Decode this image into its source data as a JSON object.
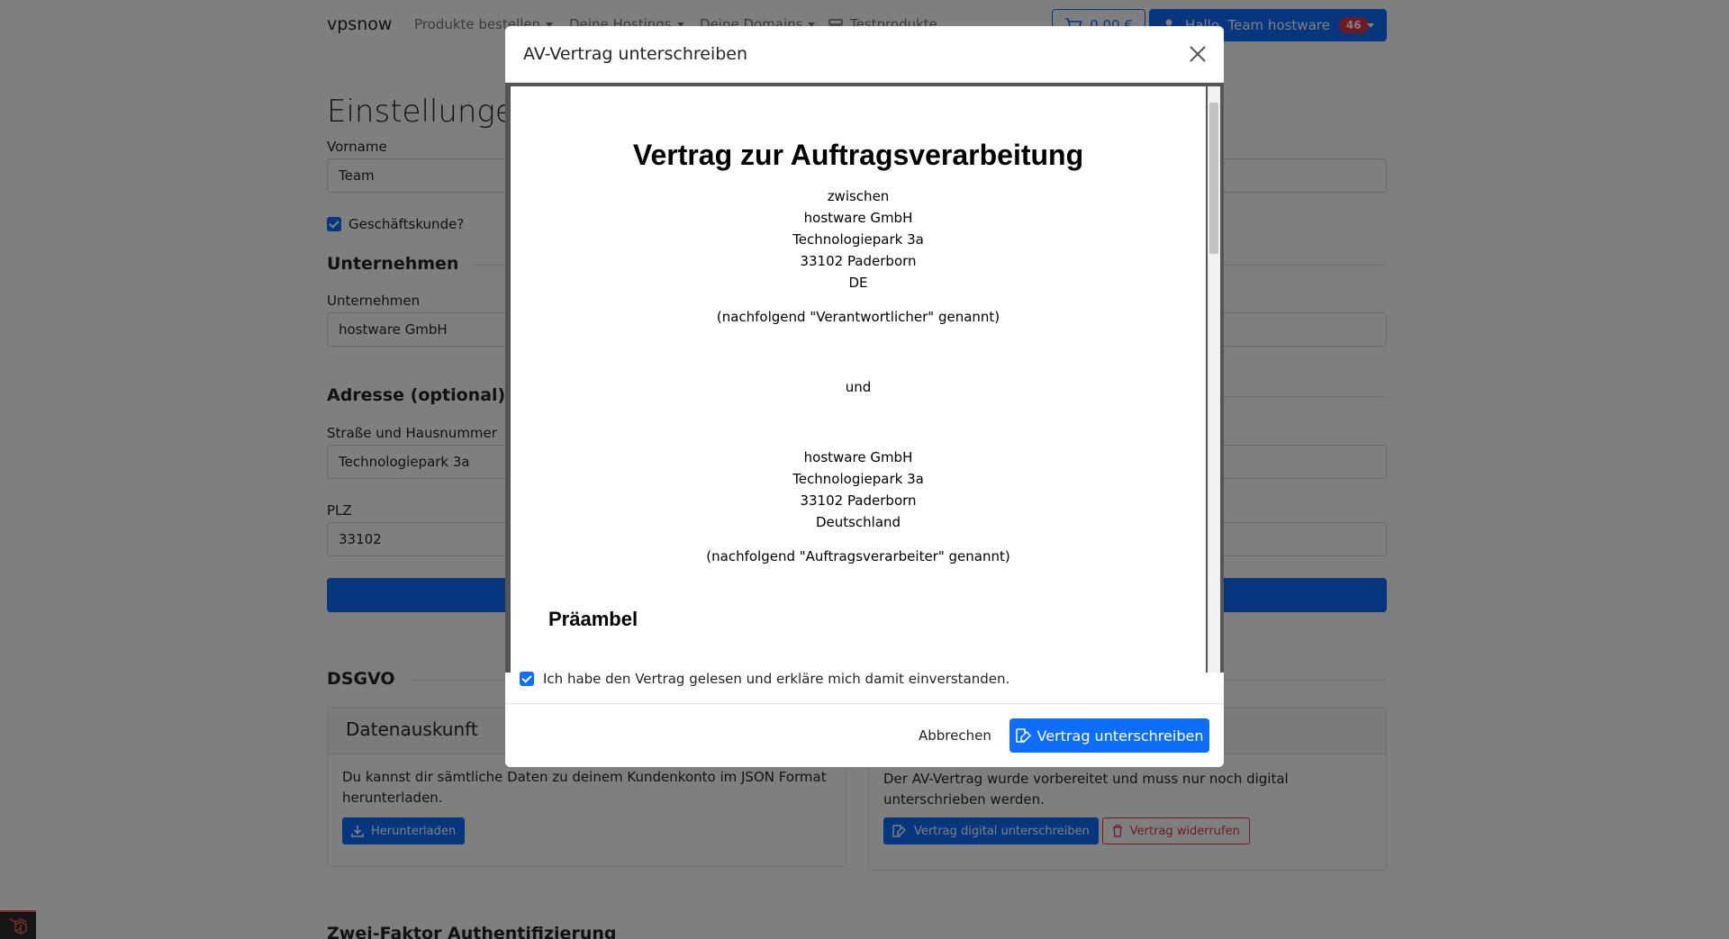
{
  "nav": {
    "brand": "vpsnow",
    "items": [
      "Produkte bestellen",
      "Deine Hostings",
      "Deine Domains",
      "Testprodukte"
    ],
    "cart_label": "0,00 €",
    "user_label": "Hallo, Team hostware",
    "user_badge": "46"
  },
  "page": {
    "title": "Einstellungen",
    "vorname_label": "Vorname",
    "vorname_value": "Team",
    "business_label": "Geschäftskunde?",
    "company_section": "Unternehmen",
    "company_label": "Unternehmen",
    "company_value": "hostware GmbH",
    "address_section": "Adresse (optional)",
    "street_label": "Straße und Hausnummer",
    "street_value": "Technologiepark 3a",
    "zip_label": "PLZ",
    "zip_value": "33102",
    "dsgvo_section": "DSGVO",
    "twofa_section": "Zwei-Faktor Authentifizierung",
    "data_card": {
      "title": "Datenauskunft",
      "text": "Du kannst dir sämtliche Daten zu deinem Kundenkonto im JSON Format herunterladen.",
      "button": "Herunterladen"
    },
    "av_card": {
      "text": "Der AV-Vertrag wurde vorbereitet und muss nur noch digital unterschrieben werden.",
      "sign_button": "Vertrag digital unterschreiben",
      "revoke_button": "Vertrag widerrufen"
    }
  },
  "modal": {
    "title": "AV-Vertrag unterschreiben",
    "document": {
      "heading": "Vertrag zur Auftragsverarbeitung",
      "between": "zwischen",
      "party1": [
        "hostware GmbH",
        "Technologiepark 3a",
        "33102 Paderborn",
        "DE"
      ],
      "party1_role": "(nachfolgend \"Verantwortlicher\" genannt)",
      "and": "und",
      "party2": [
        "hostware GmbH",
        "Technologiepark 3a",
        "33102 Paderborn",
        "Deutschland"
      ],
      "party2_role": "(nachfolgend \"Auftragsverarbeiter\" genannt)",
      "preamble": "Präambel"
    },
    "consent_label": "Ich habe den Vertrag gelesen und erkläre mich damit einverstanden.",
    "cancel_label": "Abbrechen",
    "sign_label": "Vertrag unterschreiben"
  },
  "colors": {
    "primary": "#0d6efd",
    "danger": "#dc3545"
  }
}
